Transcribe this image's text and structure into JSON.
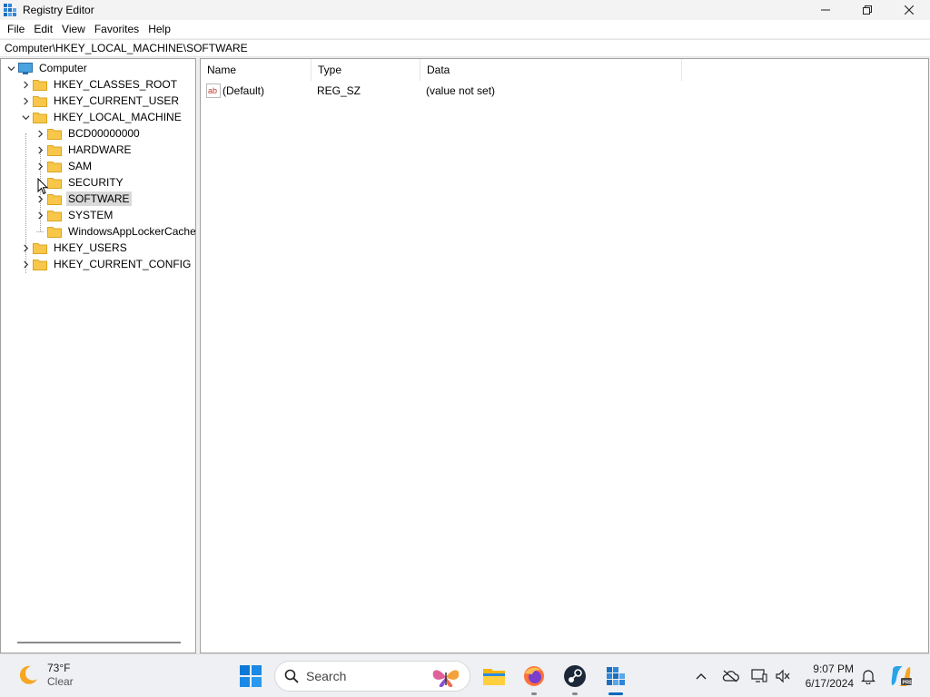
{
  "window": {
    "title": "Registry Editor",
    "controls": {
      "minimize": "—",
      "maximize": "❐",
      "close": "✕"
    }
  },
  "menu": [
    "File",
    "Edit",
    "View",
    "Favorites",
    "Help"
  ],
  "address": "Computer\\HKEY_LOCAL_MACHINE\\SOFTWARE",
  "tree": {
    "root": "Computer",
    "hives": [
      {
        "label": "HKEY_CLASSES_ROOT"
      },
      {
        "label": "HKEY_CURRENT_USER"
      },
      {
        "label": "HKEY_LOCAL_MACHINE"
      },
      {
        "label": "HKEY_USERS"
      },
      {
        "label": "HKEY_CURRENT_CONFIG"
      }
    ],
    "hklm_children": [
      {
        "label": "BCD00000000"
      },
      {
        "label": "HARDWARE"
      },
      {
        "label": "SAM"
      },
      {
        "label": "SECURITY"
      },
      {
        "label": "SOFTWARE",
        "selected": true
      },
      {
        "label": "SYSTEM"
      },
      {
        "label": "WindowsAppLockerCache"
      }
    ]
  },
  "list": {
    "columns": [
      "Name",
      "Type",
      "Data"
    ],
    "rows": [
      {
        "name": "(Default)",
        "type": "REG_SZ",
        "data": "(value not set)",
        "icon": "string-value-icon"
      }
    ]
  },
  "taskbar": {
    "weather": {
      "temp": "73°F",
      "condition": "Clear",
      "icon": "moon-icon"
    },
    "search_placeholder": "Search",
    "apps": [
      "file-explorer-icon",
      "firefox-icon",
      "steam-icon",
      "registry-editor-icon"
    ],
    "clock": {
      "time": "9:07 PM",
      "date": "6/17/2024"
    },
    "accent": "#0067c0"
  }
}
